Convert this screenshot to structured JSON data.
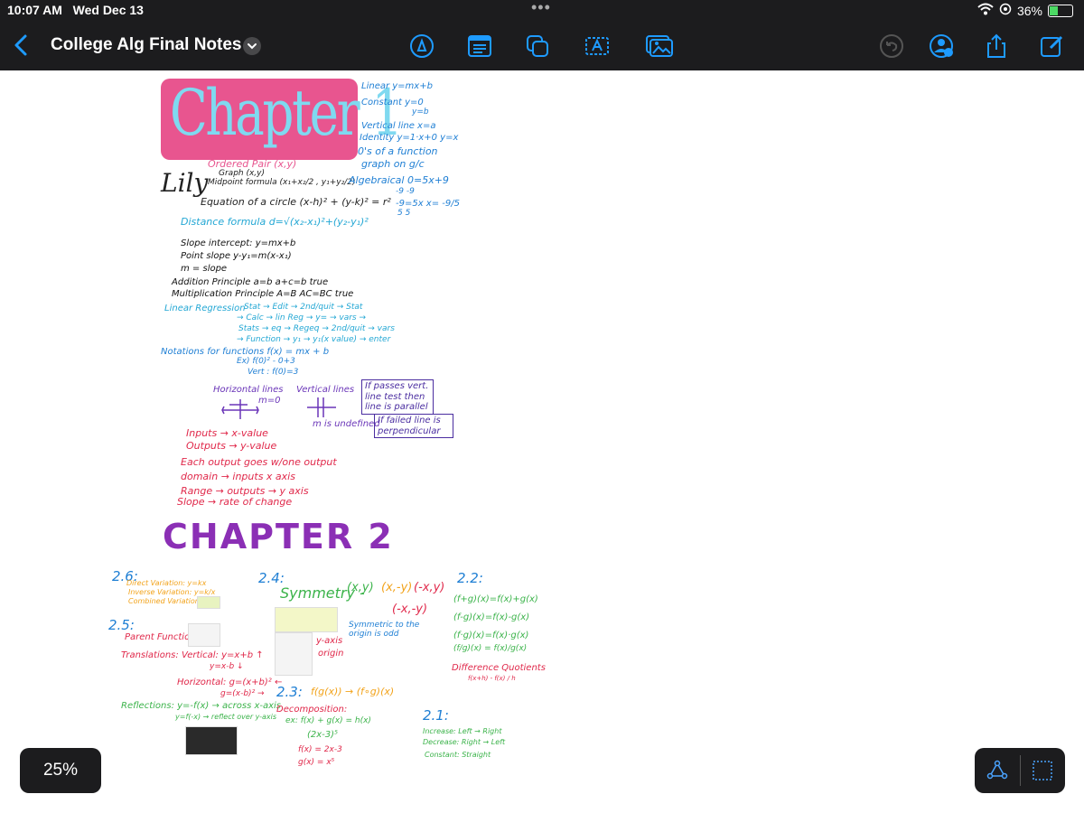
{
  "status": {
    "time": "10:07 AM",
    "date": "Wed Dec 13",
    "battery": "36%"
  },
  "toolbar": {
    "title": "College Alg Final Notes",
    "icons": [
      "pencil-tip-icon",
      "document-icon",
      "copy-icon",
      "text-box-icon",
      "image-icon",
      "undo-icon",
      "share-people-icon",
      "share-icon",
      "compose-icon"
    ]
  },
  "zoom_label": "25%",
  "colors": {
    "pink": "#e8558f",
    "blue": "#1f7fd4",
    "cyan": "#23a7d4",
    "purple": "#8b2fb5",
    "green": "#3bb34a",
    "orange": "#f2a31b",
    "red": "#e0284a"
  },
  "notes": {
    "chapter1": "Chapter 1",
    "signature": "Lily",
    "ordered_pair": "Ordered Pair (x,y)",
    "graph": "Graph (x,y)",
    "midpoint": "Midpoint formula (x₁+x₂/2 , y₁+y₂/2)",
    "circle": "Equation of a circle (x-h)² + (y-k)² = r²",
    "distance": "Distance formula d=√(x₂-x₁)²+(y₂-y₁)²",
    "slope_intercept": "Slope intercept: y=mx+b",
    "point_slope": "Point slope y-y₁=m(x-x₁)",
    "m_slope": "m = slope",
    "addition": "Addition Principle a=b a+c=b true",
    "multiplication": "Multiplication Principle A=B AC=BC true",
    "linreg_label": "Linear Regression",
    "linreg1": "Stat → Edit → 2nd/quit → Stat",
    "linreg2": "→ Calc → lin Reg → y= → vars →",
    "linreg3": "Stats → eq → Regeq → 2nd/quit → vars",
    "linreg4": "→ Function → y₁ → y₁(x value) → enter",
    "notations": "Notations for functions f(x) = mx + b",
    "ex1": "Ex) f(0)² - 0+3",
    "vert1": "Vert : f(0)=3",
    "linear": "Linear y=mx+b",
    "constant": "Constant y=0",
    "constant2": "y=b",
    "vertical_line": "Vertical line x=a",
    "identity": "Identity y=1·x+0 y=x",
    "zeros": "0's of a function",
    "graph_on": "graph on g/c",
    "algebraical": "Algebraical 0=5x+9",
    "alg2": "-9        -9",
    "alg3": "-9=5x     x= -9/5",
    "alg4": "5    5",
    "horiz_lines": "Horizontal lines",
    "m0": "m=0",
    "vert_lines": "Vertical lines",
    "m_undef": "m is undefined",
    "box1": "If passes vert. line test then line is parallel",
    "box2": "If failed line is perpendicular",
    "inputs": "Inputs → x-value",
    "outputs": "Outputs → y-value",
    "each_output": "Each output goes w/one output",
    "domain": "domain → inputs x axis",
    "range": "Range → outputs → y axis",
    "slope_rate": "Slope → rate of change",
    "chapter2": "CHAPTER 2",
    "s26": "2.6:",
    "direct": "Direct Variation: y=kx",
    "inverse": "Inverse Variation: y=k/x",
    "combined": "Combined Variation:",
    "s25": "2.5:",
    "parent": "Parent Functions:",
    "translations": "Translations: Vertical: y=x+b ↑",
    "trans2": "y=x-b ↓",
    "horizontal": "Horizontal: g=(x+b)² ←",
    "horiz2": "g=(x-b)² →",
    "reflections": "Reflections: y=-f(x) → across x-axis",
    "refl2": "y=f(-x) → reflect over y-axis",
    "s24": "2.4:",
    "symmetry": "Symmetry -",
    "sym_xy": "(x,y)",
    "sym_x_negy": "(x,-y)",
    "sym_negx_y": "(-x,y)",
    "sym_negx_negy": "(-x,-y)",
    "sym_origin": "Symmetric to the origin is odd",
    "y_axis": "y-axis",
    "origin": "origin",
    "s23": "2.3:",
    "composition": "f(g(x)) → (f∘g)(x)",
    "decomposition": "Decomposition:",
    "decomp_ex": "ex: f(x) + g(x) = h(x)",
    "decomp2": "(2x-3)⁵",
    "decomp3": "f(x) = 2x-3",
    "decomp4": "g(x) = x⁵",
    "s22": "2.2:",
    "fg_sum": "(f+g)(x)=f(x)+g(x)",
    "fg_diff": "(f-g)(x)=f(x)-g(x)",
    "fg_prod": "(f·g)(x)=f(x)·g(x)",
    "fg_quot": "(f/g)(x) = f(x)/g(x)",
    "diff_quot": "Difference Quotients",
    "diff_formula": "f(x+h) - f(x) / h",
    "s21": "2.1:",
    "increase": "Increase: Left → Right",
    "decrease": "Decrease: Right → Left",
    "constant_s": "Constant: Straight"
  }
}
